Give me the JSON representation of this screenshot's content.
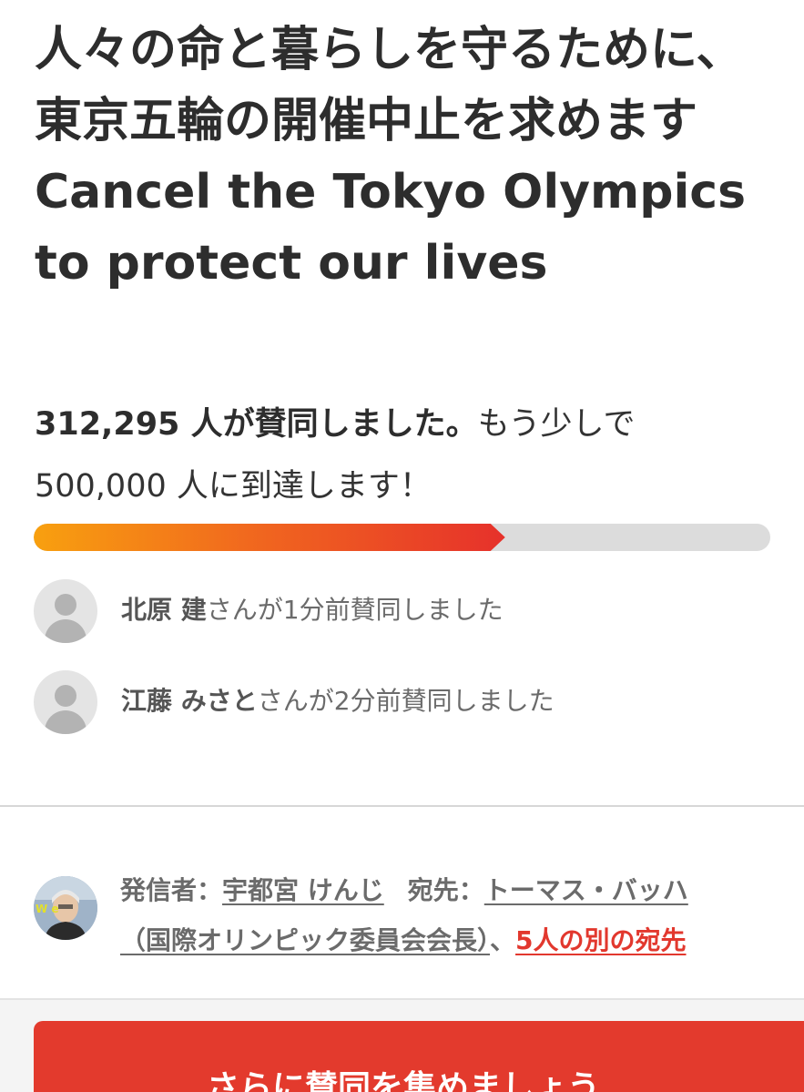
{
  "petition": {
    "title": "人々の命と暮らしを守るために、東京五輪の開催中止を求めます Cancel the Tokyo Olympics to protect our lives"
  },
  "progress": {
    "signed_count_text": "312,295 人が賛同しました。",
    "goal_text_1": "もう少しで",
    "goal_text_2": "500,000 人に到達します！",
    "signed": 312295,
    "goal": 500000,
    "fill_percent": 64
  },
  "recent_signers": [
    {
      "name": "北原 建",
      "action": "さんが1分前賛同しました"
    },
    {
      "name": "江藤 みさと",
      "action": "さんが2分前賛同しました"
    }
  ],
  "starter": {
    "label": "発信者：",
    "name": "宇都宮 けんじ",
    "recipient_label": "宛先：",
    "recipient_name": "トーマス・バッハ",
    "recipient_title": "（国際オリンピック委員会会長）",
    "separator": "、",
    "other_recipients": "5人の別の宛先",
    "avatar_badge": "W e"
  },
  "cta": {
    "label": "さらに賛同を集めましょう"
  },
  "colors": {
    "accent": "#e33a2d",
    "progress_start": "#f8a00f",
    "progress_end": "#e6312b",
    "track": "#dcdcdc"
  },
  "icons": {
    "signer_avatar": "default-user-avatar-icon",
    "starter_avatar": "user-photo-avatar"
  }
}
